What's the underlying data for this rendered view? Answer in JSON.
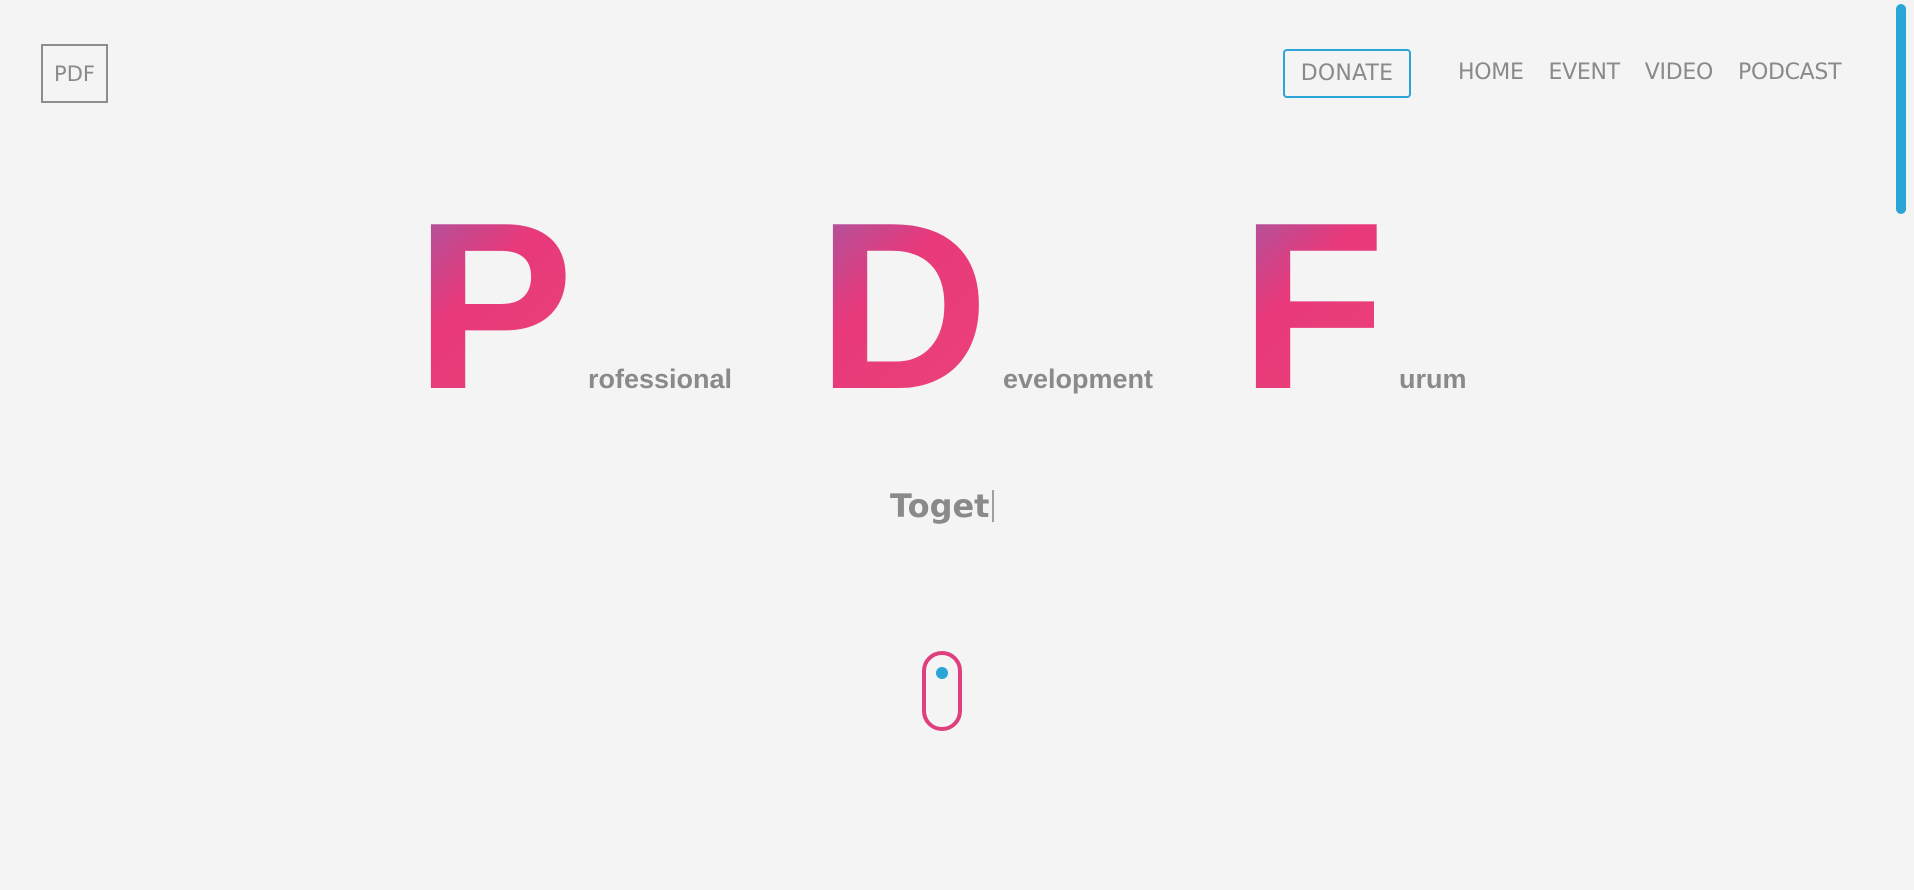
{
  "logo": {
    "label": "PDF"
  },
  "header": {
    "donate_label": "DONATE",
    "nav": [
      "HOME",
      "EVENT",
      "VIDEO",
      "PODCAST"
    ]
  },
  "hero": {
    "letters": [
      {
        "initial": "P",
        "rest": "rofessional"
      },
      {
        "initial": "D",
        "rest": "evelopment"
      },
      {
        "initial": "F",
        "rest": "urum"
      }
    ],
    "tagline": "Toget"
  },
  "colors": {
    "accent_blue": "#2aa5d6",
    "accent_pink": "#e8397b",
    "accent_purple": "#9c5ba6",
    "text_gray": "#8a8a8a",
    "background": "#f4f4f4"
  },
  "icons": {
    "scroll_indicator": "mouse-scroll-icon"
  }
}
